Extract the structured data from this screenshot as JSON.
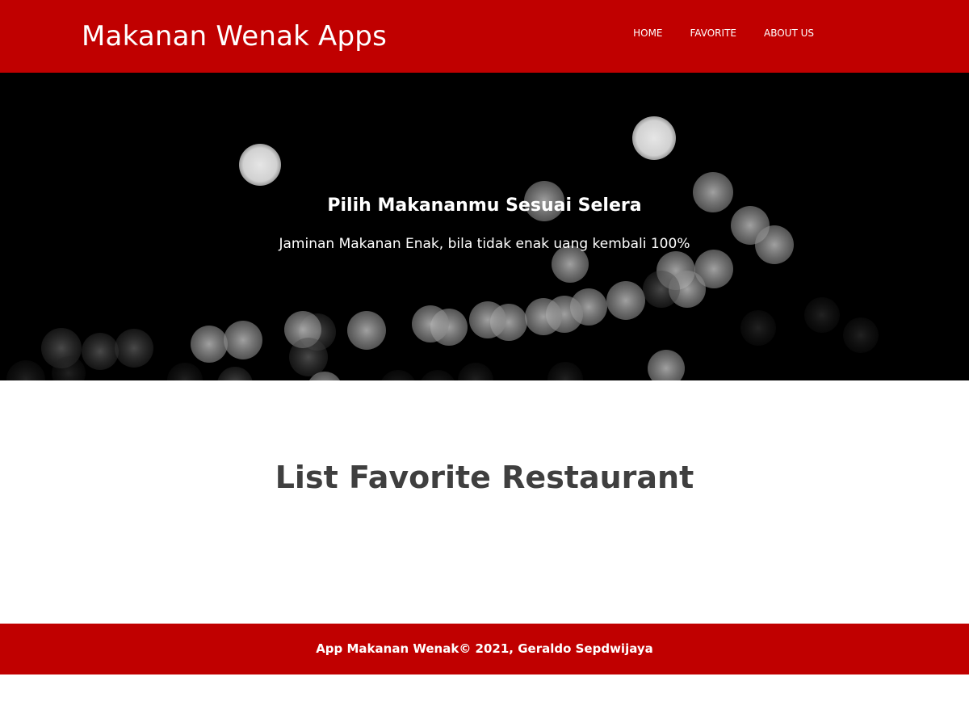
{
  "header": {
    "title": "Makanan Wenak Apps",
    "nav": [
      {
        "label": "HOME"
      },
      {
        "label": "FAVORITE"
      },
      {
        "label": "ABOUT US"
      }
    ]
  },
  "hero": {
    "title": "Pilih Makananmu Sesuai Selera",
    "subtitle": "Jaminan Makanan Enak, bila tidak enak uang kembali 100%"
  },
  "main": {
    "title": "List Favorite Restaurant"
  },
  "footer": {
    "text": "App Makanan Wenak© 2021, Geraldo Sepdwijaya"
  },
  "colors": {
    "brand": "#c00000",
    "hero_bg": "#000000",
    "heading": "#3f3f3f",
    "white": "#ffffff"
  }
}
